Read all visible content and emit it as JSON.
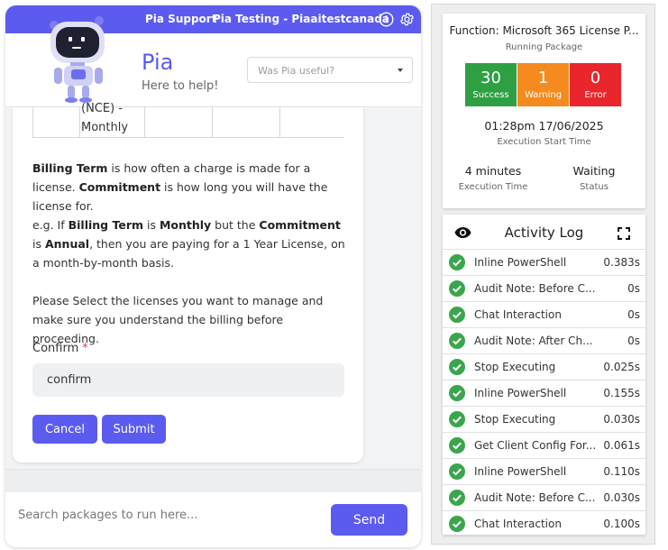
{
  "topbar": {
    "support_label": "Pia Support",
    "tenant_label": "Pia Testing - Piaaitestcanada",
    "info_icon": "info-icon",
    "settings_icon": "gear-icon"
  },
  "header": {
    "name": "Pia",
    "tagline": "Here to help!",
    "feedback_placeholder": "Was Pia useful?"
  },
  "form": {
    "table_fragment": [
      "(NCE) -",
      "Monthly"
    ],
    "para1": [
      {
        "text": "Billing Term",
        "bold": true
      },
      {
        "text": " is how often a charge is made for a license. ",
        "bold": false
      },
      {
        "text": "Commitment",
        "bold": true
      },
      {
        "text": " is how long you will have the license for.",
        "bold": false
      }
    ],
    "para2": [
      {
        "text": "e.g. If ",
        "bold": false
      },
      {
        "text": "Billing Term",
        "bold": true
      },
      {
        "text": " is ",
        "bold": false
      },
      {
        "text": "Monthly",
        "bold": true
      },
      {
        "text": " but the ",
        "bold": false
      },
      {
        "text": "Commitment",
        "bold": true
      },
      {
        "text": " is ",
        "bold": false
      },
      {
        "text": "Annual",
        "bold": true
      },
      {
        "text": ", then you are paying for a 1 Year License, on a month-by-month basis.",
        "bold": false
      }
    ],
    "para3": "Please Select the licenses you want to manage and make sure you understand the billing before proceeding.",
    "confirm_label": "Confirm",
    "confirm_required_mark": "*",
    "confirm_value": "confirm",
    "cancel_label": "Cancel",
    "submit_label": "Submit"
  },
  "search": {
    "placeholder": "Search packages to run here...",
    "send_label": "Send"
  },
  "summary": {
    "function_title": "Function: Microsoft 365 License P...",
    "subtitle": "Running Package",
    "stats": [
      {
        "value": "30",
        "label": "Success",
        "color": "#2ea043"
      },
      {
        "value": "1",
        "label": "Warning",
        "color": "#f58a1f"
      },
      {
        "value": "0",
        "label": "Error",
        "color": "#e8262b"
      }
    ],
    "start_time": "01:28pm 17/06/2025",
    "start_label": "Execution Start Time",
    "exec_time_value": "4 minutes",
    "exec_time_label": "Execution Time",
    "status_value": "Waiting",
    "status_label": "Status"
  },
  "activity_log": {
    "title": "Activity Log",
    "eye_icon": "eye-icon",
    "expand_icon": "fullscreen-icon",
    "items": [
      {
        "name": "Inline PowerShell",
        "duration": "0.383s"
      },
      {
        "name": "Audit Note: Before C...",
        "duration": "0s"
      },
      {
        "name": "Chat Interaction",
        "duration": "0s"
      },
      {
        "name": "Audit Note: After Ch...",
        "duration": "0s"
      },
      {
        "name": "Stop Executing",
        "duration": "0.025s"
      },
      {
        "name": "Inline PowerShell",
        "duration": "0.155s"
      },
      {
        "name": "Stop Executing",
        "duration": "0.030s"
      },
      {
        "name": "Get Client Config For...",
        "duration": "0.061s"
      },
      {
        "name": "Inline PowerShell",
        "duration": "0.110s"
      },
      {
        "name": "Audit Note: Before C...",
        "duration": "0.030s"
      },
      {
        "name": "Chat Interaction",
        "duration": "0.100s"
      }
    ]
  }
}
